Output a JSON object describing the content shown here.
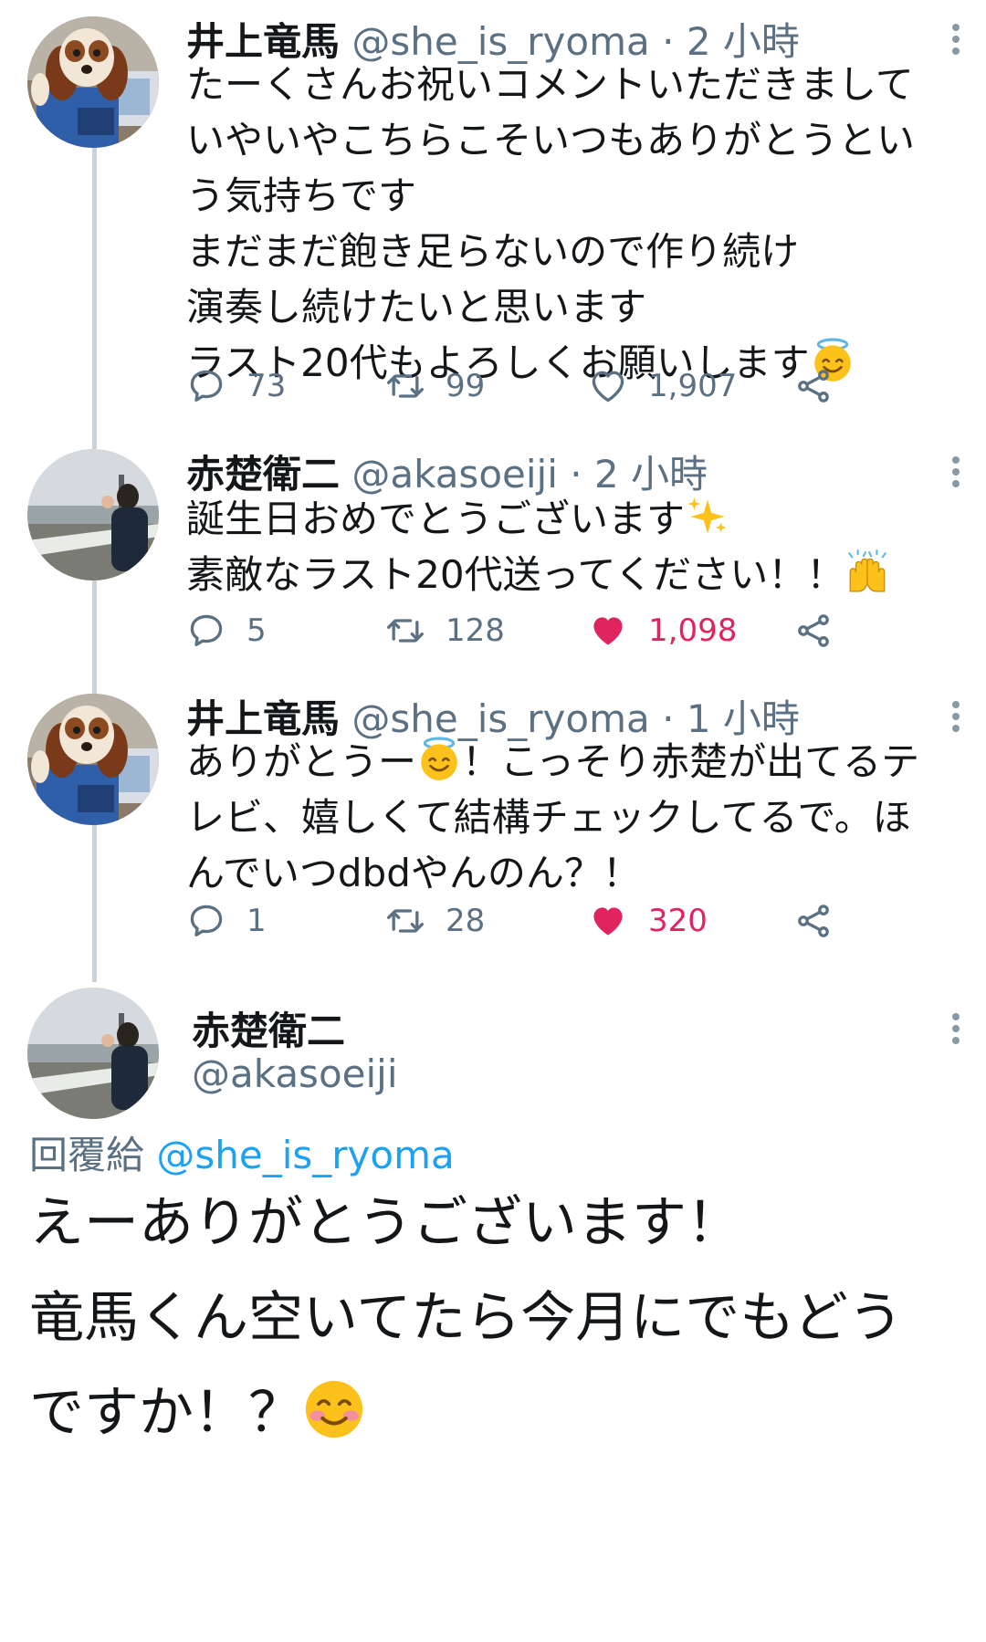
{
  "tweets": [
    {
      "name": "井上竜馬",
      "handle": "@she_is_ryoma",
      "separator": "·",
      "time": "2 小時",
      "lines": [
        "たーくさんお祝いコメントいただきまして",
        "いやいやこちらこそいつもありがとうとい",
        "う気持ちです",
        "まだまだ飽き足らないので作り続け",
        "演奏し続けたいと思います",
        "ラスト20代もよろしくお願いします"
      ],
      "replies": "73",
      "retweets": "99",
      "likes": "1,907",
      "liked": false
    },
    {
      "name": "赤楚衛二",
      "handle": "@akasoeiji",
      "separator": "·",
      "time": "2 小時",
      "lines": [
        "誕生日おめでとうございます",
        "素敵なラスト20代送ってください！！"
      ],
      "replies": "5",
      "retweets": "128",
      "likes": "1,098",
      "liked": true
    },
    {
      "name": "井上竜馬",
      "handle": "@she_is_ryoma",
      "separator": "·",
      "time": "1 小時",
      "lines": [
        "ありがとうー",
        "！こっそり赤楚が出てるテ",
        "レビ、嬉しくて結構チェックしてるで。ほ",
        "んでいつdbdやんのん？！"
      ],
      "replies": "1",
      "retweets": "28",
      "likes": "320",
      "liked": true
    }
  ],
  "main_tweet": {
    "name": "赤楚衛二",
    "handle": "@akasoeiji",
    "reply_prefix": "回覆給",
    "reply_target": "@she_is_ryoma",
    "lines": [
      "えーありがとうございます！",
      "竜馬くん空いてたら今月にでもどう",
      "ですか！？"
    ]
  },
  "icons": {
    "reply": "reply-bubble-icon",
    "retweet": "retweet-icon",
    "like": "heart-icon",
    "share": "share-icon",
    "more": "vertical-ellipsis-icon",
    "emoji_halo": "smiling-face-with-halo",
    "emoji_sparkles": "sparkles",
    "emoji_raised_hands": "raised-hands",
    "emoji_blush": "smiling-face-with-smiling-eyes"
  },
  "colors": {
    "like_active": "#e0245e",
    "link": "#1da1f2",
    "muted": "#5b7083",
    "thread_line": "#c9d3dc"
  }
}
